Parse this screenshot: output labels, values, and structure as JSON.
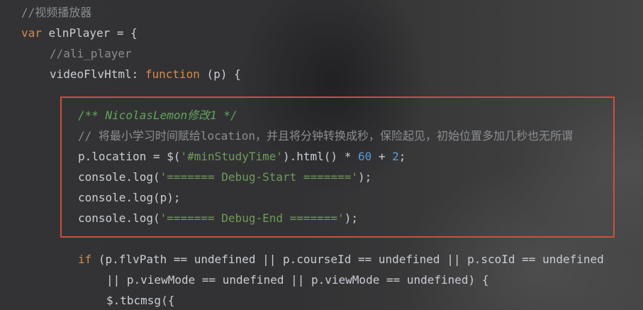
{
  "code_lines": [
    {
      "indent": "",
      "tokens": [
        {
          "t": "//视频播放器",
          "c": "comment"
        }
      ]
    },
    {
      "indent": "",
      "tokens": [
        {
          "t": "var",
          "c": "keyword"
        },
        {
          "t": " elnPlayer = {",
          "c": "plain"
        }
      ]
    },
    {
      "indent": "    ",
      "tokens": [
        {
          "t": "//ali_player",
          "c": "comment"
        }
      ]
    },
    {
      "indent": "    ",
      "tokens": [
        {
          "t": "videoFlvHtml: ",
          "c": "plain"
        },
        {
          "t": "function",
          "c": "keyword"
        },
        {
          "t": " (p) {",
          "c": "plain"
        }
      ]
    },
    {
      "indent": "",
      "tokens": []
    },
    {
      "indent": "        ",
      "tokens": [
        {
          "t": "/** NicolasLemon修改1 */",
          "c": "doc"
        }
      ]
    },
    {
      "indent": "        ",
      "tokens": [
        {
          "t": "// 将最小学习时间赋给location，并且将分钟转换成秒，保险起见，初始位置多加几秒也无所谓",
          "c": "comment"
        }
      ]
    },
    {
      "indent": "        ",
      "tokens": [
        {
          "t": "p.location = $(",
          "c": "plain"
        },
        {
          "t": "'#minStudyTime'",
          "c": "string"
        },
        {
          "t": ").html() * ",
          "c": "plain"
        },
        {
          "t": "60",
          "c": "number"
        },
        {
          "t": " + ",
          "c": "plain"
        },
        {
          "t": "2",
          "c": "number"
        },
        {
          "t": ";",
          "c": "plain"
        }
      ]
    },
    {
      "indent": "        ",
      "tokens": [
        {
          "t": "console.log(",
          "c": "plain"
        },
        {
          "t": "'======= Debug-Start ======='",
          "c": "string"
        },
        {
          "t": ");",
          "c": "plain"
        }
      ]
    },
    {
      "indent": "        ",
      "tokens": [
        {
          "t": "console.log(p);",
          "c": "plain"
        }
      ]
    },
    {
      "indent": "        ",
      "tokens": [
        {
          "t": "console.log(",
          "c": "plain"
        },
        {
          "t": "'======= Debug-End ======='",
          "c": "string"
        },
        {
          "t": ");",
          "c": "plain"
        }
      ]
    },
    {
      "indent": "",
      "tokens": []
    },
    {
      "indent": "        ",
      "tokens": [
        {
          "t": "if",
          "c": "keyword"
        },
        {
          "t": " (p.flvPath == ",
          "c": "plain"
        },
        {
          "t": "undefined",
          "c": "undefined"
        },
        {
          "t": " || p.courseId == ",
          "c": "plain"
        },
        {
          "t": "undefined",
          "c": "undefined"
        },
        {
          "t": " || p.scoId == ",
          "c": "plain"
        },
        {
          "t": "undefined",
          "c": "undefined"
        }
      ]
    },
    {
      "indent": "            ",
      "tokens": [
        {
          "t": "|| p.viewMode == ",
          "c": "plain"
        },
        {
          "t": "undefined",
          "c": "undefined"
        },
        {
          "t": " || p.viewMode == ",
          "c": "plain"
        },
        {
          "t": "undefined",
          "c": "undefined"
        },
        {
          "t": ") {",
          "c": "plain"
        }
      ]
    },
    {
      "indent": "            ",
      "tokens": [
        {
          "t": "$.tbcmsg({",
          "c": "plain"
        }
      ]
    }
  ],
  "colors": {
    "comment": "#8a8d90",
    "doc_comment": "#62a45a",
    "keyword": "#d48b4c",
    "string": "#6f9a5a",
    "number": "#5b9bd5",
    "plain": "#c9cdd3",
    "highlight_border": "#c9513d"
  }
}
